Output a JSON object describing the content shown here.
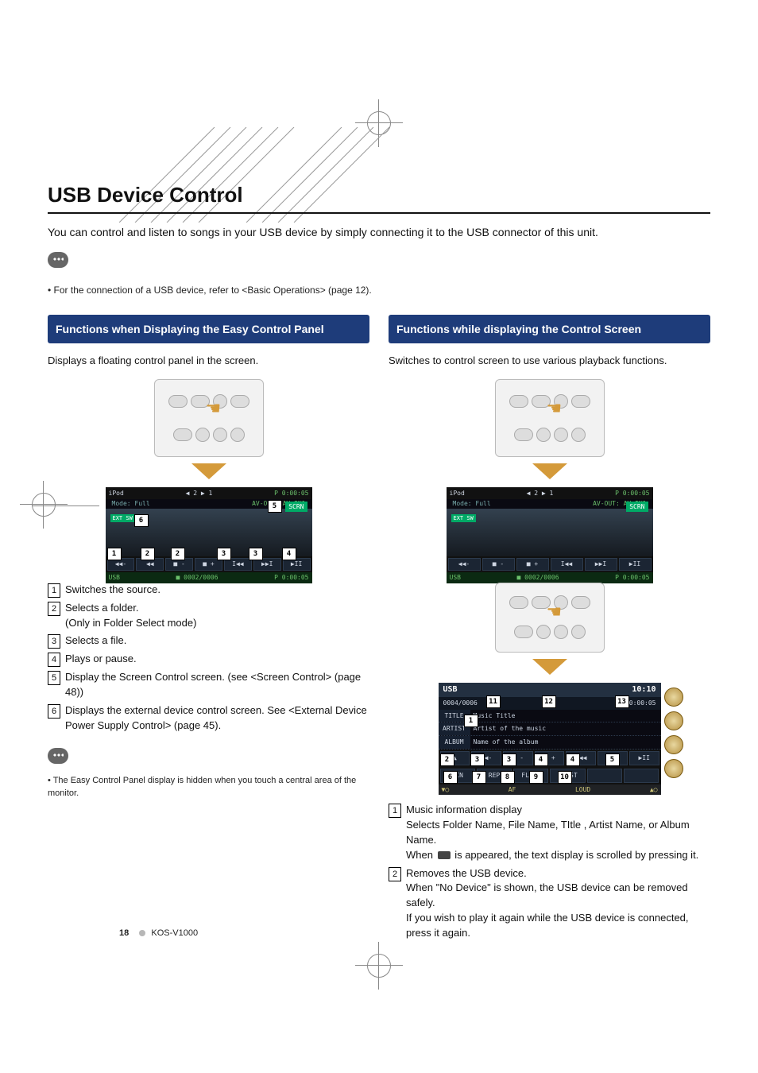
{
  "page": {
    "section_title": "USB Device Control",
    "intro": "You can control and listen to songs in your USB device by simply connecting it to the USB connector of this unit.",
    "connection_note": "• For the connection of a USB device, refer to <Basic Operations> (page 12).",
    "footer_page": "18",
    "footer_model": "KOS-V1000"
  },
  "left_panel": {
    "heading": "Functions when Displaying the Easy Control Panel",
    "lead": "Displays a floating control panel in the screen.",
    "screenshot": {
      "title_left": "iPod",
      "title_center_icons": "◀ 2   ▶ 1",
      "title_right": "P 0:00:05",
      "mode": "Mode: Full",
      "avout": "AV-OUT: AV-IN1",
      "scrn": "SCRN",
      "extsw": "EXT SW",
      "status_left": "USB",
      "status_center": "■ 0002/0006",
      "status_right": "P   0:00:05",
      "controls": [
        "◀◀-",
        "◀◀",
        "■ -",
        "■ +",
        "I◀◀",
        "▶▶I",
        "▶II"
      ],
      "callouts": {
        "c1": "1",
        "c2": "2",
        "c3": "3",
        "c4": "4",
        "c5": "5",
        "c6": "6"
      }
    },
    "items": [
      {
        "n": "1",
        "text": "Switches the source."
      },
      {
        "n": "2",
        "text": "Selects a folder.",
        "sub": "(Only in Folder Select mode)"
      },
      {
        "n": "3",
        "text": "Selects a file."
      },
      {
        "n": "4",
        "text": "Plays or pause."
      },
      {
        "n": "5",
        "text": "Display the Screen Control screen. (see <Screen Control> (page 48))"
      },
      {
        "n": "6",
        "text": "Displays the external device control screen. See <External Device Power Supply Control> (page 45)."
      }
    ],
    "tail_note": "• The Easy Control Panel display is hidden when you touch a central area of the monitor."
  },
  "right_panel": {
    "heading": "Functions while displaying the Control Screen",
    "lead": "Switches to control screen to use various playback functions.",
    "screenshot1": {
      "title_left": "iPod",
      "title_center_icons": "◀ 2   ▶ 1",
      "title_right": "P 0:00:05",
      "mode": "Mode: Full",
      "avout": "AV-OUT: AV-IN1",
      "scrn": "SCRN",
      "extsw": "EXT SW",
      "status_left": "USB",
      "status_center": "■ 0002/0006",
      "status_right": "P   0:00:05",
      "controls": [
        "◀◀-",
        "■ -",
        "■ +",
        "I◀◀",
        "▶▶I",
        "▶II"
      ]
    },
    "screenshot2": {
      "header_left": "USB",
      "clock": "10:10",
      "track": "0004/0006",
      "play_icon": "▶",
      "time": "P   0:00:05",
      "rows": [
        {
          "lbl": "TITLE",
          "val": "Music Title"
        },
        {
          "lbl": "ARTIST",
          "val": "Artist of the music"
        },
        {
          "lbl": "ALBUM",
          "val": "Name of the album"
        }
      ],
      "btn_row1": [
        "▲",
        "◀◀-",
        "■ -",
        "■ +",
        "I◀◀",
        "▶▶I",
        "▶II"
      ],
      "btn_row2": [
        "SCN",
        "REP",
        "FLIST",
        "PLIST",
        "",
        ""
      ],
      "bottom_left": "AF",
      "bottom_right": "LOUD",
      "callouts": {
        "c1": "1",
        "c2": "2",
        "c3": "3",
        "c4": "4",
        "c5": "5",
        "c6": "6",
        "c7": "7",
        "c8": "8",
        "c9": "9",
        "c10": "10",
        "c11": "11",
        "c12": "12",
        "c13": "13"
      }
    },
    "items": [
      {
        "n": "1",
        "text": "Music information display",
        "sub": "Selects Folder Name, File Name, TItle , Artist Name, or Album Name.",
        "sub2a": "When ",
        "sub2b": " is appeared, the text display is scrolled by pressing it."
      },
      {
        "n": "2",
        "text": "Removes the USB device.",
        "sub": "When \"No Device\" is shown, the USB device can be removed safely.",
        "sub2": "If you wish to play it again while the USB device is connected, press it again."
      }
    ]
  }
}
